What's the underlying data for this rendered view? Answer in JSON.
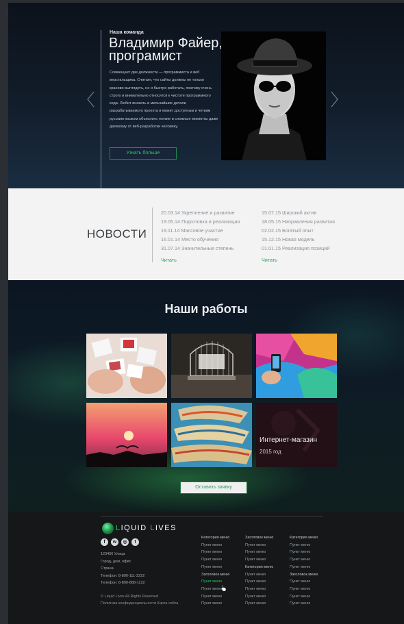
{
  "hero": {
    "kicker": "Наша команда",
    "name": "Владимир Файер, програмист",
    "description": "Совмещает две должности — программиста и веб верстальщика. Считает, что сайты должны не только красиво выглядеть, но и быстро работать, поэтому очень строго и внимательно относится к чистоте программного кода. Любит вникать в мельчайшие детали разрабатываемого проекта и может доступным и четким русским языком объяснить тонкие и сложные моменты даже далекому от веб-разработки человеку.",
    "more_button": "Узнать больше",
    "prev_icon": "chevron-left-icon",
    "next_icon": "chevron-right-icon"
  },
  "news": {
    "title": "НОВОСТИ",
    "col1": [
      "20.03.14 Укрепление и развитие",
      "19.05.14 Подготовка и реализация",
      "19.11.14 Массовое участие",
      "16.01.14 Место обучения",
      "31.07.14 Значительные степень"
    ],
    "col2": [
      "15.07.15 Широкий актив",
      "18.05.15 Направления развития",
      "02.02.15 Богатый опыт",
      "15.12.15 Новая модель",
      "01.01.15 Реализация позиций"
    ],
    "read_label": "Читать"
  },
  "works": {
    "title": "Наши работы",
    "featured_title": "Интернет-магазин",
    "featured_year": "2015 год",
    "order_button": "Оставить заявку"
  },
  "footer": {
    "logo_first": "IQUID",
    "logo_second": "IVES",
    "logo_l1": "L",
    "logo_l2": "L",
    "socials": [
      "f",
      "vk",
      "ig",
      "tw"
    ],
    "address": [
      "123456 Улица",
      "Город, дом, офис",
      "Страна",
      "Телефон: 8-800-111-2222",
      "Телефон: 8-800-888-1122"
    ],
    "copyright": [
      "© Liquid Lives All Rights Reserved",
      "Политика конфиденциальности   Карта сайта"
    ],
    "col1": [
      "Категория меню",
      "Пункт меню",
      "Пункт меню",
      "Пункт меню",
      "Пункт меню",
      "Заголовок меню",
      "Пункт меню",
      "Пункт меню",
      "Пункт меню",
      "Пункт меню"
    ],
    "col2": [
      "Заголовок меню",
      "Пункт меню",
      "Пункт меню",
      "Пункт меню",
      "Категория меню",
      "Пункт меню",
      "Пункт меню",
      "Пункт меню",
      "Пункт меню",
      "Пункт меню"
    ],
    "col3": [
      "Категория меню",
      "Пункт меню",
      "Пункт меню",
      "Пункт меню",
      "Пункт меню",
      "Заголовок меню",
      "Пункт меню",
      "Пункт меню",
      "Пункт меню",
      "Пункт меню"
    ],
    "accent_color": "#2fbf6a"
  }
}
